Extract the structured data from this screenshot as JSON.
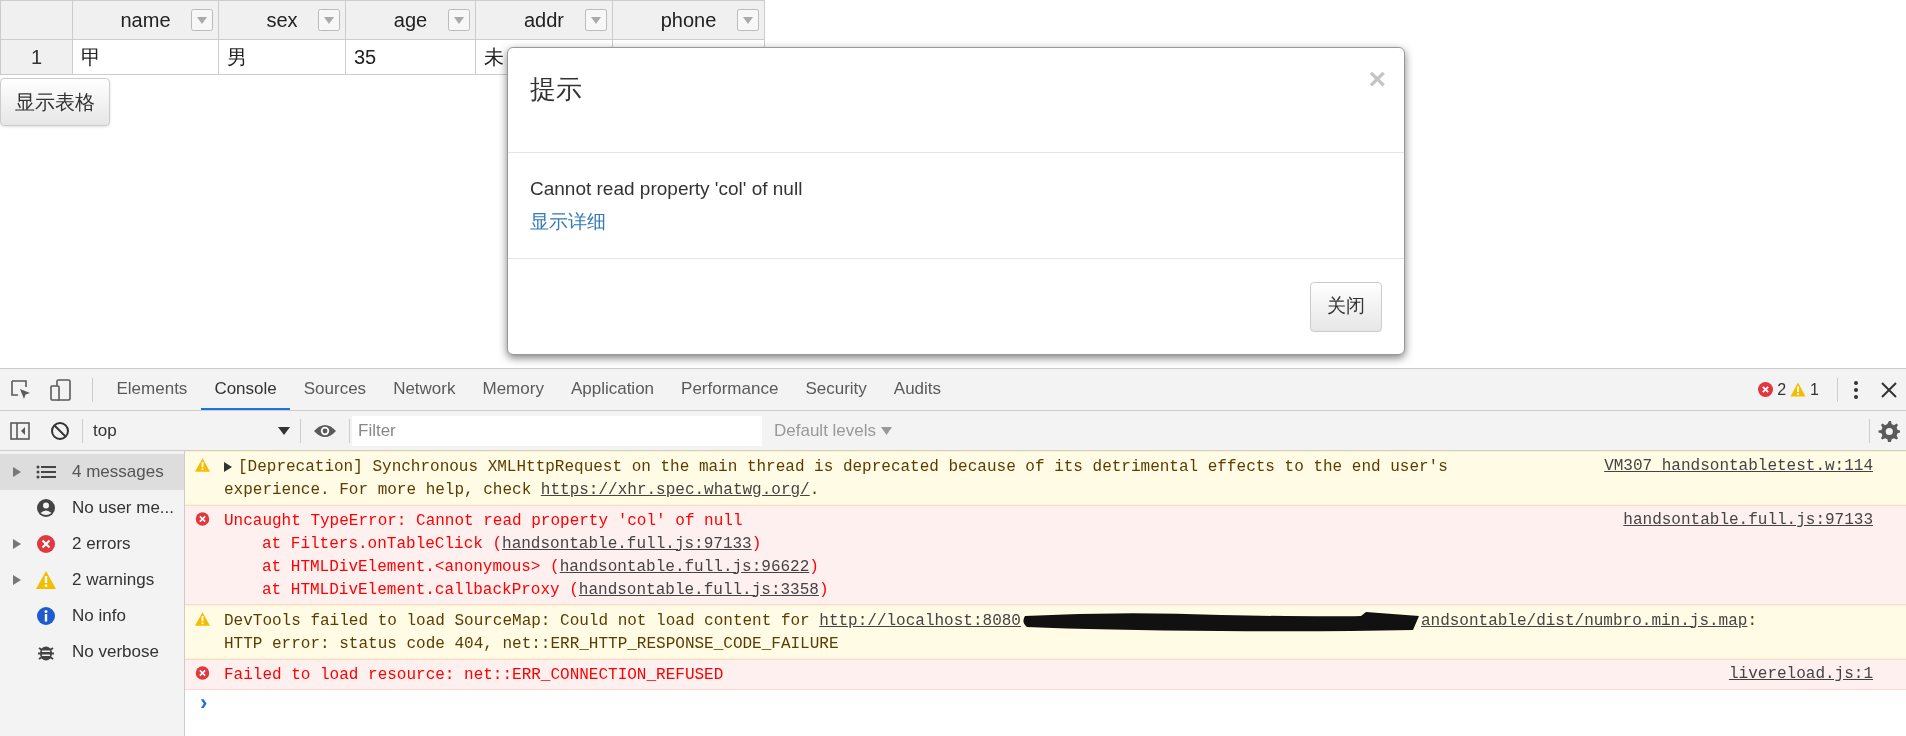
{
  "table": {
    "columns": [
      {
        "label": "name"
      },
      {
        "label": "sex"
      },
      {
        "label": "age"
      },
      {
        "label": "addr"
      },
      {
        "label": "phone"
      }
    ],
    "rows": [
      {
        "number": "1",
        "cells": [
          "甲",
          "男",
          "35",
          "未"
        ]
      }
    ]
  },
  "show_table_button": "显示表格",
  "dialog": {
    "title": "提示",
    "close_glyph": "×",
    "message": "Cannot read property 'col' of null",
    "details_link": "显示详细",
    "buttons": [
      "关闭"
    ]
  },
  "devtools": {
    "tabs": [
      {
        "label": "Elements",
        "selected": false
      },
      {
        "label": "Console",
        "selected": true
      },
      {
        "label": "Sources",
        "selected": false
      },
      {
        "label": "Network",
        "selected": false
      },
      {
        "label": "Memory",
        "selected": false
      },
      {
        "label": "Application",
        "selected": false
      },
      {
        "label": "Performance",
        "selected": false
      },
      {
        "label": "Security",
        "selected": false
      },
      {
        "label": "Audits",
        "selected": false
      }
    ],
    "error_count": "2",
    "warning_count": "1",
    "context": "top",
    "filter_placeholder": "Filter",
    "levels": "Default levels",
    "sidebar": [
      {
        "kind": "messages",
        "label": "4 messages",
        "selected": true,
        "expandable": true
      },
      {
        "kind": "user",
        "label": "No user me...",
        "selected": false,
        "expandable": false
      },
      {
        "kind": "error",
        "label": "2 errors",
        "selected": false,
        "expandable": true
      },
      {
        "kind": "warning",
        "label": "2 warnings",
        "selected": false,
        "expandable": true
      },
      {
        "kind": "info",
        "label": "No info",
        "selected": false,
        "expandable": false
      },
      {
        "kind": "verbose",
        "label": "No verbose",
        "selected": false,
        "expandable": false
      }
    ],
    "messages": [
      {
        "kind": "warning",
        "expandable": true,
        "source": "VM307 handsontabletest.w:114",
        "lines": [
          {
            "kind": "main",
            "segments": [
              {
                "kind": "text",
                "text": "[Deprecation] Synchronous XMLHttpRequest on the main thread is deprecated because of its detrimental effects to the end user's"
              }
            ]
          },
          {
            "kind": "main",
            "segments": [
              {
                "kind": "text",
                "text": "experience. For more help, check "
              },
              {
                "kind": "link",
                "text": "https://xhr.spec.whatwg.org/"
              },
              {
                "kind": "text",
                "text": "."
              }
            ]
          }
        ]
      },
      {
        "kind": "error",
        "expandable": false,
        "source": "handsontable.full.js:97133",
        "lines": [
          {
            "kind": "main",
            "segments": [
              {
                "kind": "text",
                "text": "Uncaught TypeError: Cannot read property 'col' of null"
              }
            ]
          },
          {
            "kind": "stack",
            "segments": [
              {
                "kind": "text",
                "text": "at Filters.onTableClick ("
              },
              {
                "kind": "link",
                "text": "handsontable.full.js:97133"
              },
              {
                "kind": "text",
                "text": ")"
              }
            ]
          },
          {
            "kind": "stack",
            "segments": [
              {
                "kind": "text",
                "text": "at HTMLDivElement.<anonymous> ("
              },
              {
                "kind": "link",
                "text": "handsontable.full.js:96622"
              },
              {
                "kind": "text",
                "text": ")"
              }
            ]
          },
          {
            "kind": "stack",
            "segments": [
              {
                "kind": "text",
                "text": "at HTMLDivElement.callbackProxy ("
              },
              {
                "kind": "link",
                "text": "handsontable.full.js:3358"
              },
              {
                "kind": "text",
                "text": ")"
              }
            ]
          }
        ]
      },
      {
        "kind": "warning",
        "expandable": false,
        "lines": [
          {
            "kind": "main",
            "segments": [
              {
                "kind": "text",
                "text": "DevTools failed to load SourceMap: Could not load content for "
              },
              {
                "kind": "link",
                "text": "http://localhost:8080"
              },
              {
                "kind": "redacted"
              },
              {
                "kind": "link",
                "text": "andsontable/dist/numbro.min.js.map"
              },
              {
                "kind": "text",
                "text": ":"
              }
            ]
          },
          {
            "kind": "main",
            "segments": [
              {
                "kind": "text",
                "text": "HTTP error: status code 404, net::ERR_HTTP_RESPONSE_CODE_FAILURE"
              }
            ]
          }
        ]
      },
      {
        "kind": "error",
        "expandable": false,
        "source": "livereload.js:1",
        "lines": [
          {
            "kind": "main",
            "segments": [
              {
                "kind": "text",
                "text": "Failed to load resource: net::ERR_CONNECTION_REFUSED"
              }
            ]
          }
        ]
      }
    ],
    "prompt": "›"
  }
}
